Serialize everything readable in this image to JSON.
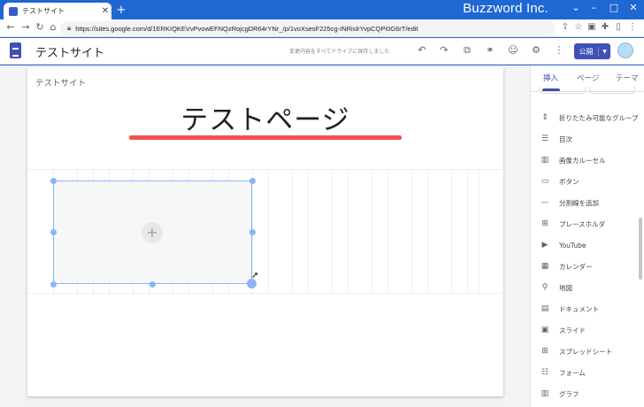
{
  "browser": {
    "tab_title": "テストサイト",
    "tab_close": "✕",
    "new_tab": "+",
    "brand": "Buzzword Inc.",
    "url": "https://sites.google.com/d/1ERKIQKEVvPvowEFNQzRojcgDR64rYNr_/p/1voXsesF225cg-INRislrYvpCQPi0G6rT/edit"
  },
  "appbar": {
    "site_name": "テストサイト",
    "save_status": "変更内容をすべてドライブに保存しました",
    "publish_label": "公開"
  },
  "canvas": {
    "site_label": "テストサイト",
    "page_title": "テストページ",
    "add_symbol": "+"
  },
  "panel": {
    "tabs": [
      "挿入",
      "ページ",
      "テーマ"
    ],
    "items": [
      {
        "label": "折りたたみ可能なグループ",
        "icon": "collapsible-icon"
      },
      {
        "label": "目次",
        "icon": "toc-icon"
      },
      {
        "label": "画像カルーセル",
        "icon": "carousel-icon"
      },
      {
        "label": "ボタン",
        "icon": "button-icon"
      },
      {
        "label": "分割線を追加",
        "icon": "divider-icon"
      },
      {
        "label": "プレースホルダ",
        "icon": "placeholder-icon"
      },
      {
        "label": "YouTube",
        "icon": "youtube-icon"
      },
      {
        "label": "カレンダー",
        "icon": "calendar-icon"
      },
      {
        "label": "地図",
        "icon": "map-icon"
      },
      {
        "label": "ドキュメント",
        "icon": "docs-icon"
      },
      {
        "label": "スライド",
        "icon": "slides-icon"
      },
      {
        "label": "スプレッドシート",
        "icon": "sheets-icon"
      },
      {
        "label": "フォーム",
        "icon": "forms-icon"
      },
      {
        "label": "グラフ",
        "icon": "chart-icon"
      }
    ]
  },
  "colors": {
    "chrome_blue": "#1f67d2",
    "sites_indigo": "#3f51b5",
    "title_underline": "#f4514f",
    "selection_blue": "#8ab4f8"
  }
}
